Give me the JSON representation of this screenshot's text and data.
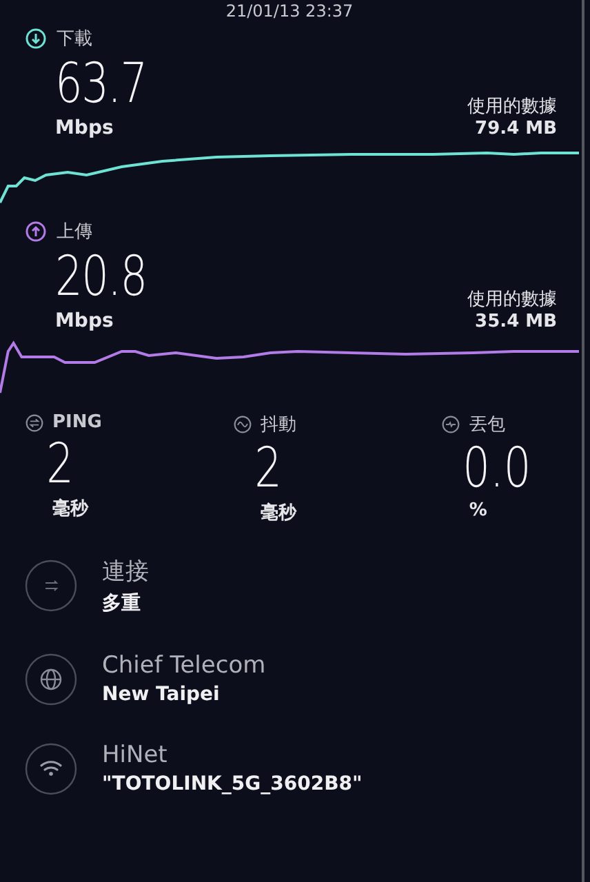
{
  "timestamp": "21/01/13 23:37",
  "speeds": [
    {
      "kind": "download",
      "label": "下載",
      "value": "63.7",
      "unit": "Mbps",
      "data_label": "使用的數據",
      "data_value": "79.4 MB",
      "color": "#6fe3d3"
    },
    {
      "kind": "upload",
      "label": "上傳",
      "value": "20.8",
      "unit": "Mbps",
      "data_label": "使用的數據",
      "data_value": "35.4 MB",
      "color": "#b27be6"
    }
  ],
  "stats": [
    {
      "kind": "ping",
      "label": "PING",
      "value": "2",
      "unit": "毫秒"
    },
    {
      "kind": "jitter",
      "label": "抖動",
      "value": "2",
      "unit": "毫秒"
    },
    {
      "kind": "loss",
      "label": "丟包",
      "value": "0.0",
      "unit": "%"
    }
  ],
  "details": [
    {
      "kind": "connections",
      "title": "連接",
      "subtitle": "多重"
    },
    {
      "kind": "server",
      "title": "Chief Telecom",
      "subtitle": "New Taipei"
    },
    {
      "kind": "network",
      "title": "HiNet",
      "subtitle": "\"TOTOLINK_5G_3602B8\""
    }
  ]
}
